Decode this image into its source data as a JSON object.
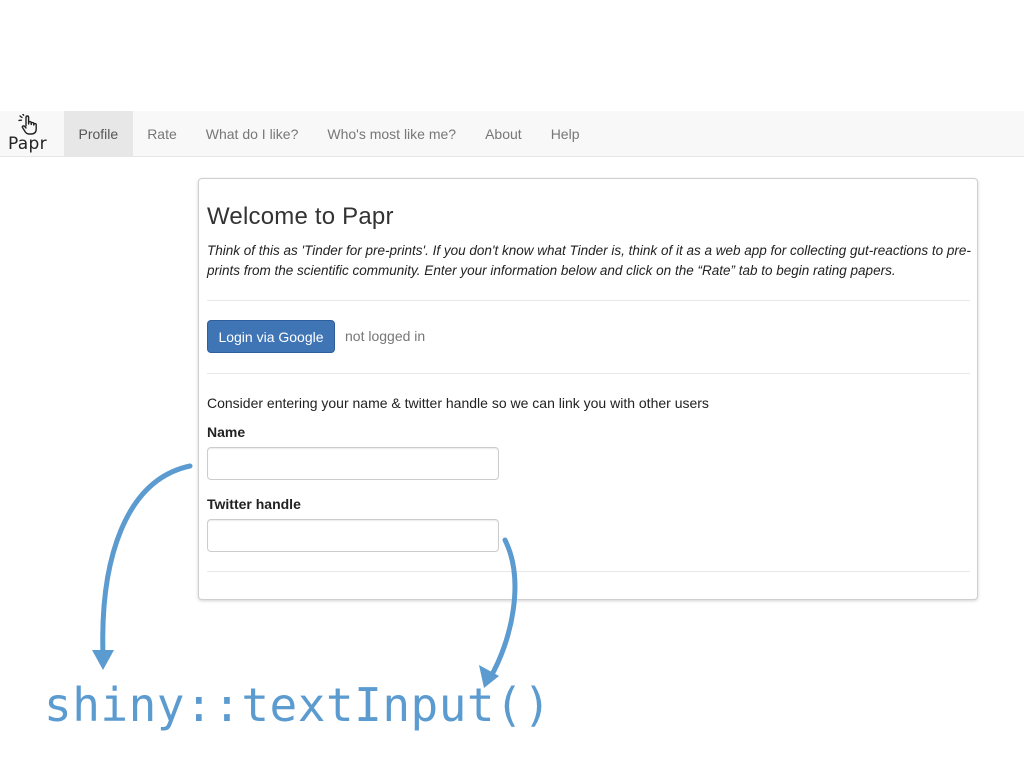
{
  "navbar": {
    "brand_text": "Papr",
    "brand_icon": "pointing-hand-icon",
    "items": [
      {
        "label": "Profile",
        "active": true
      },
      {
        "label": "Rate",
        "active": false
      },
      {
        "label": "What do I like?",
        "active": false
      },
      {
        "label": "Who's most like me?",
        "active": false
      },
      {
        "label": "About",
        "active": false
      },
      {
        "label": "Help",
        "active": false
      }
    ]
  },
  "panel": {
    "title": "Welcome to Papr",
    "intro": "Think of this as 'Tinder for pre-prints'. If you don't know what Tinder is, think of it as a web app for collecting gut-reactions to pre-prints from the scientific community. Enter your information below and click on the “Rate” tab to begin rating papers.",
    "login_button": "Login via Google",
    "login_status": "not logged in",
    "consider_text": "Consider entering your name & twitter handle so we can link you with other users",
    "name_label": "Name",
    "name_value": "",
    "twitter_label": "Twitter handle",
    "twitter_value": ""
  },
  "annotation": {
    "text": "shiny::textInput()",
    "color": "#5b9bd0"
  },
  "colors": {
    "accent": "#3f74b5",
    "navbar_bg": "#f8f8f8",
    "annotation": "#5b9bd0"
  }
}
